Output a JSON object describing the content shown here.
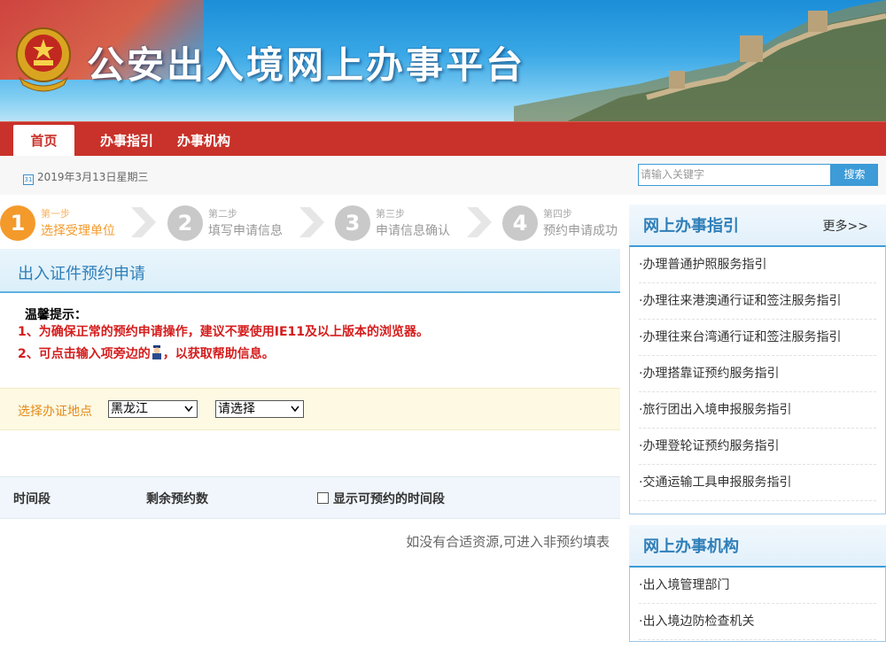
{
  "header": {
    "site_title": "公安出入境网上办事平台"
  },
  "nav": {
    "items": [
      "首页",
      "办事指引",
      "办事机构"
    ]
  },
  "topbar": {
    "date": "2019年3月13日星期三",
    "search_placeholder": "请输入关键字",
    "search_button": "搜索"
  },
  "steps": [
    {
      "num": "1",
      "step": "第一步",
      "label": "选择受理单位",
      "active": true
    },
    {
      "num": "2",
      "step": "第二步",
      "label": "填写申请信息",
      "active": false
    },
    {
      "num": "3",
      "step": "第三步",
      "label": "申请信息确认",
      "active": false
    },
    {
      "num": "4",
      "step": "第四步",
      "label": "预约申请成功",
      "active": false
    }
  ],
  "form": {
    "title": "出入证件预约申请",
    "tips_title": "温馨提示：",
    "tip1": "1、为确保正常的预约申请操作，建议不要使用IE11及以上版本的浏览器。",
    "tip2_before": "2、可点击输入项旁边的",
    "tip2_after": "，以获取帮助信息。",
    "place_label": "选择办证地点",
    "province_value": "黑龙江",
    "office_value": "请选择",
    "col_time": "时间段",
    "col_remaining": "剩余预约数",
    "show_available": "显示可预约的时间段",
    "note": "如没有合适资源,可进入非预约填表"
  },
  "sidebar": {
    "guide": {
      "title": "网上办事指引",
      "more": "更多>>",
      "items": [
        "·办理普通护照服务指引",
        "·办理往来港澳通行证和签注服务指引",
        "·办理往来台湾通行证和签注服务指引",
        "·办理搭靠证预约服务指引",
        "·旅行团出入境申报服务指引",
        "·办理登轮证预约服务指引",
        "·交通运输工具申报服务指引"
      ]
    },
    "orgs": {
      "title": "网上办事机构",
      "items": [
        "·出入境管理部门",
        "·出入境边防检查机关"
      ]
    }
  },
  "colors": {
    "nav_red": "#c8322a",
    "accent_blue": "#2f7fb8",
    "step_active": "#f39a2b",
    "tip_red": "#d51d1d"
  }
}
